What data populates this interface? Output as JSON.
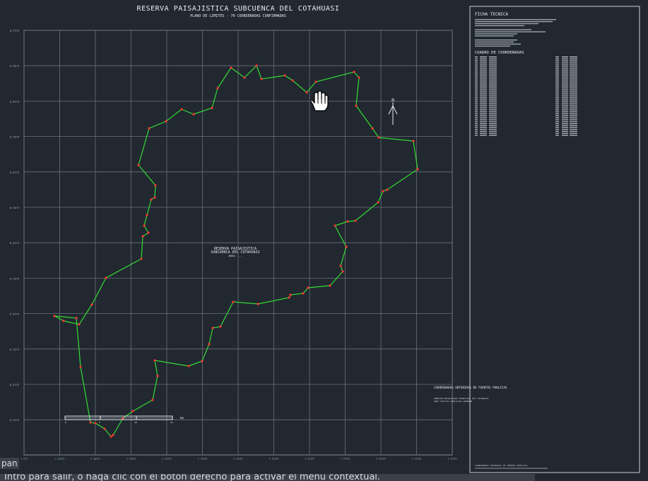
{
  "drawing": {
    "title": "RESERVA PAISAJISTICA SUBCUENCA DEL COTAHUASI",
    "subtitle": "PLANO DE LIMITES - 70 COORDENADAS CONFIRMADAS",
    "center_label_1": "RESERVA PAISAJISTICA",
    "center_label_2": "SUBCUENCA DEL COTAHUASI",
    "center_label_3": "AREA: ---",
    "north_label": "N",
    "y_ticks": [
      "8 7????",
      "8 ?6???",
      "8 6????",
      "8 ?5???",
      "8 5????",
      "8 ?4???",
      "8 4????",
      "8 ?3???",
      "8 3????",
      "8 ?2???",
      "8 2????",
      "8 ?1???"
    ],
    "x_ticks": [
      "? ???",
      "? 1????",
      "? ?5???",
      "? ?????",
      "? ?????",
      "? ?????",
      "? ?????",
      "? ?????",
      "? ?????",
      "? ?????",
      "? ?????",
      "? ?????",
      "? ?????"
    ],
    "note_title": "COORDENADAS OBTENIDAS DE FUENTES PUBLICAS",
    "note_line_1": "DERECHO REGULATORIO MUNICIPAL DEL COTAHUASI",
    "note_line_2": "AREA OFICIAL PUBLICADA SERNANP",
    "color_boundary": "#33dd33",
    "color_vertex": "#ff3333",
    "color_grid": "#6b717a"
  },
  "ficha": {
    "title": "FICHA TECNICA",
    "table_title": "CUADRO DE COORDENADAS",
    "footer": "COORDENADAS OBTENIDAS DE FUENTES PUBLICAS"
  },
  "command": {
    "label": "pan",
    "prompt": "Intro para salir, o haga clic con el botón derecho para activar el menú contextual."
  },
  "cursor": {
    "icon": "hand-pan-icon"
  }
}
